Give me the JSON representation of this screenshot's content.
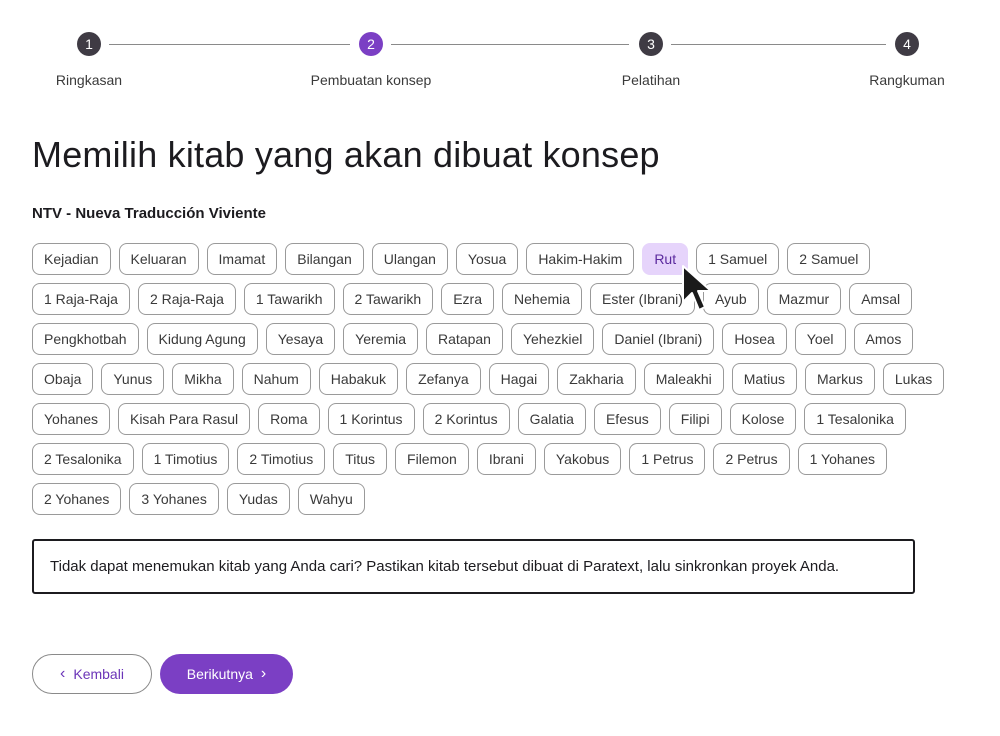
{
  "stepper": {
    "steps": [
      {
        "number": "1",
        "label": "Ringkasan"
      },
      {
        "number": "2",
        "label": "Pembuatan konsep"
      },
      {
        "number": "3",
        "label": "Pelatihan"
      },
      {
        "number": "4",
        "label": "Rangkuman"
      }
    ],
    "active_step": 2,
    "active_color": "#7b3fc4"
  },
  "page_title": "Memilih kitab yang akan dibuat konsep",
  "project_name": "NTV - Nueva Traducción Viviente",
  "books": [
    "Kejadian",
    "Keluaran",
    "Imamat",
    "Bilangan",
    "Ulangan",
    "Yosua",
    "Hakim-Hakim",
    "Rut",
    "1 Samuel",
    "2 Samuel",
    "1 Raja-Raja",
    "2 Raja-Raja",
    "1 Tawarikh",
    "2 Tawarikh",
    "Ezra",
    "Nehemia",
    "Ester (Ibrani)",
    "Ayub",
    "Mazmur",
    "Amsal",
    "Pengkhotbah",
    "Kidung Agung",
    "Yesaya",
    "Yeremia",
    "Ratapan",
    "Yehezkiel",
    "Daniel (Ibrani)",
    "Hosea",
    "Yoel",
    "Amos",
    "Obaja",
    "Yunus",
    "Mikha",
    "Nahum",
    "Habakuk",
    "Zefanya",
    "Hagai",
    "Zakharia",
    "Maleakhi",
    "Matius",
    "Markus",
    "Lukas",
    "Yohanes",
    "Kisah Para Rasul",
    "Roma",
    "1 Korintus",
    "2 Korintus",
    "Galatia",
    "Efesus",
    "Filipi",
    "Kolose",
    "1 Tesalonika",
    "2 Tesalonika",
    "1 Timotius",
    "2 Timotius",
    "Titus",
    "Filemon",
    "Ibrani",
    "Yakobus",
    "1 Petrus",
    "2 Petrus",
    "1 Yohanes",
    "2 Yohanes",
    "3 Yohanes",
    "Yudas",
    "Wahyu"
  ],
  "selected_book": "Rut",
  "selected_color": "#e6d4fb",
  "notice": "Tidak dapat menemukan kitab yang Anda cari? Pastikan kitab tersebut dibuat di Paratext, lalu sinkronkan proyek Anda.",
  "buttons": {
    "back_label": "Kembali",
    "back_icon": "chevron-left-icon",
    "next_label": "Berikutnya",
    "next_icon": "chevron-right-icon"
  },
  "cursor_icon": "mouse-pointer-icon"
}
